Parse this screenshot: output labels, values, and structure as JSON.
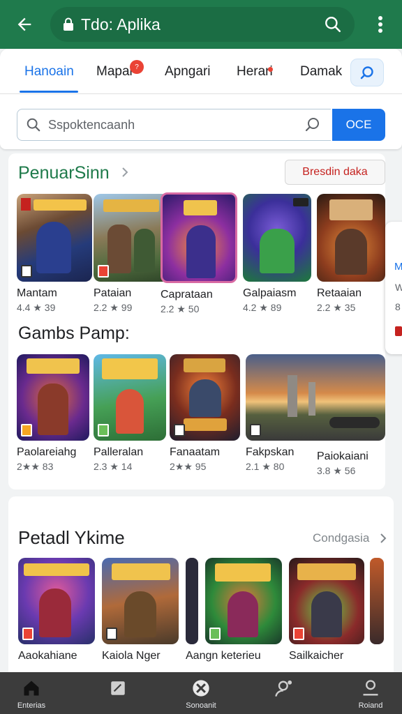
{
  "header": {
    "title": "Tdo: Aplika",
    "colors": {
      "bar": "#1f7a4c",
      "accent": "#1a73e8"
    }
  },
  "tabs": [
    {
      "label": "Hanoain",
      "active": true
    },
    {
      "label": "Mapai",
      "badge": "?"
    },
    {
      "label": "Apngari"
    },
    {
      "label": "Herari",
      "dot": true
    },
    {
      "label": "Damak"
    }
  ],
  "search": {
    "placeholder": "Sspoktencaanh",
    "button_label": "OCE"
  },
  "section1": {
    "title": "PenuarSinn",
    "button_label": "Bresdin daka",
    "apps": [
      {
        "name": "Mantam",
        "rating": "4.4 ★ 39",
        "icon": "game-art"
      },
      {
        "name": "Pataian",
        "rating": "2.2 ★ 99",
        "icon": "game-art"
      },
      {
        "name": "Caprataan",
        "rating": "2.2 ★ 50",
        "icon": "game-art"
      },
      {
        "name": "Galpaiasm",
        "rating": "4.2 ★ 89",
        "icon": "game-art"
      },
      {
        "name": "Retaaian",
        "rating": "2.2 ★ 35",
        "icon": "game-art"
      }
    ]
  },
  "section2": {
    "title": "Gambs Pamp:",
    "apps": [
      {
        "name": "Paolareiahg",
        "rating": "2★★ 83",
        "icon": "game-art"
      },
      {
        "name": "Palleralan",
        "rating": "2.3 ★ 14",
        "icon": "game-art"
      },
      {
        "name": "Fanaatam",
        "rating": "2★★ 95",
        "icon": "game-art"
      },
      {
        "name": "Fakpskan",
        "rating": "2.1 ★ 80",
        "icon": "landscape-art"
      },
      {
        "name": "Paiokaiani",
        "rating": "3.8 ★ 56",
        "icon": "game-art"
      }
    ]
  },
  "section3": {
    "title": "Petadl Ykime",
    "link_label": "Condgasia",
    "apps": [
      {
        "name": "Aaokahiane",
        "icon": "game-art"
      },
      {
        "name": "Kaiola Nger",
        "icon": "game-art"
      },
      {
        "name": "Aangn keterieu",
        "icon": "game-art"
      },
      {
        "name": "Sailkaicher",
        "icon": "game-art"
      }
    ]
  },
  "peek": {
    "t1": "M",
    "t2": "W",
    "t3": "8"
  },
  "bottom_nav": [
    {
      "label": "Enterias",
      "icon": "home-icon",
      "active": true
    },
    {
      "label": "",
      "icon": "tablet-icon"
    },
    {
      "label": "Sonoanit",
      "icon": "games-icon"
    },
    {
      "label": "",
      "icon": "person-icon"
    },
    {
      "label": "Roiand",
      "icon": "account-icon"
    }
  ]
}
